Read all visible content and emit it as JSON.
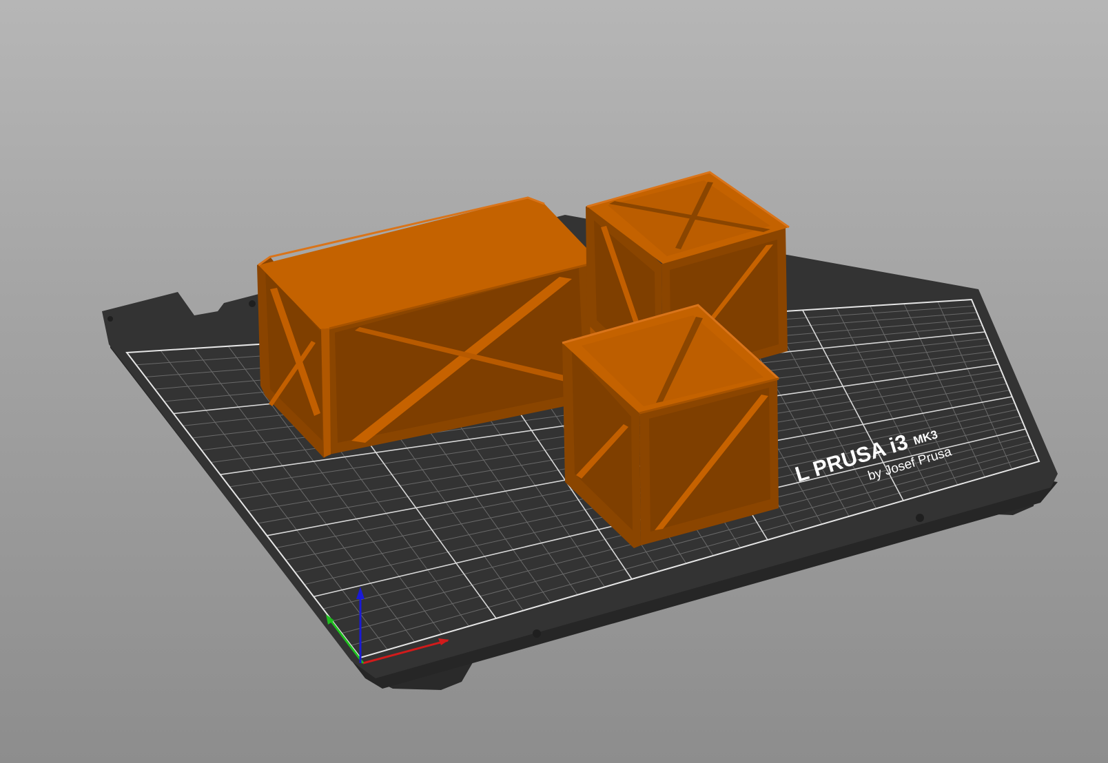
{
  "app": {
    "name": "3D plater viewport"
  },
  "bed": {
    "logo_main": "L PRUSA i3",
    "logo_model": "MK3",
    "logo_sub": "by Josef Prusa",
    "plate_color": "#323232",
    "grid_color": "#ffffff"
  },
  "objects": [
    {
      "name": "crate-large",
      "kind": "rectangular crate",
      "color": "#c46200"
    },
    {
      "name": "crate-back",
      "kind": "cube crate",
      "color": "#c46200"
    },
    {
      "name": "crate-front",
      "kind": "cube crate",
      "color": "#c46200"
    }
  ],
  "axes": {
    "x_color": "#d11b1b",
    "y_color": "#1fbf1f",
    "z_color": "#1a1ad6"
  },
  "icons": [
    "axes-gizmo-icon"
  ]
}
